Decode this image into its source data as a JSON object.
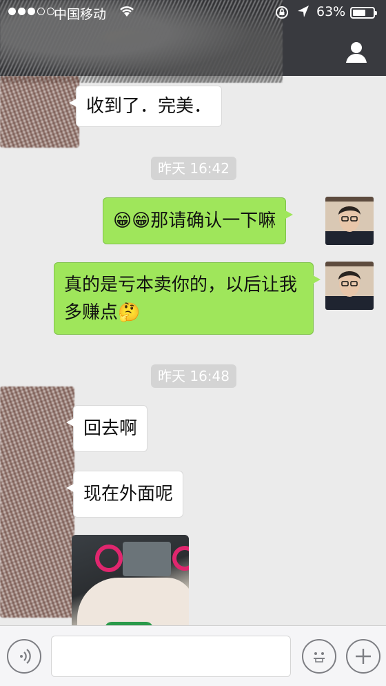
{
  "status_bar": {
    "carrier": "中国移动",
    "battery_percent": "63%",
    "battery_level": 0.63
  },
  "header": {
    "profile_icon": "person-icon"
  },
  "messages": [
    {
      "side": "in",
      "text": "收到了．完美．"
    },
    {
      "side": "out",
      "text": "😁😁那请确认一下嘛"
    },
    {
      "side": "out",
      "text": "真的是亏本卖你的，以后让我多赚点🤔"
    },
    {
      "side": "in",
      "text": "回去啊"
    },
    {
      "side": "in",
      "text": "现在外面呢"
    }
  ],
  "timestamps": [
    "昨天 16:42",
    "昨天 16:48"
  ],
  "input_bar": {
    "voice_icon": "voice-icon",
    "emoji_icon": "emoji-icon",
    "add_icon": "plus-icon",
    "input_value": ""
  },
  "colors": {
    "header_bg": "#393a3f",
    "chat_bg": "#ebebeb",
    "outgoing_bubble": "#9fe65b",
    "incoming_bubble": "#ffffff"
  }
}
